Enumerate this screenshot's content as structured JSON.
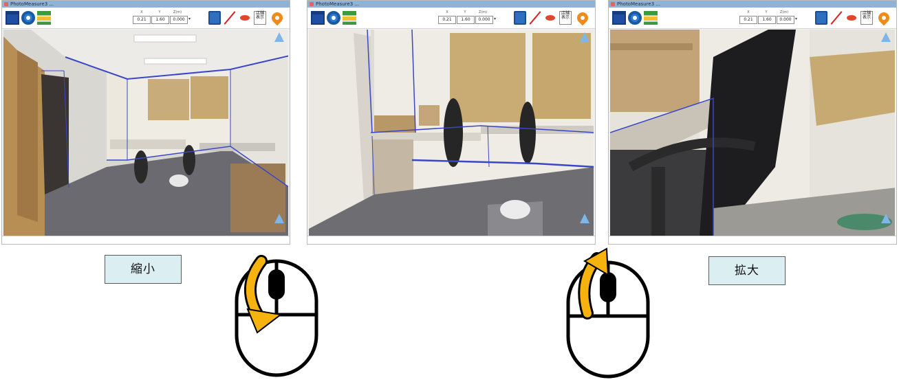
{
  "windows": [
    {
      "id": "zoomed-out",
      "title": "PhotoMeasure3 ...",
      "coords": {
        "x_label": "X",
        "y_label": "Y",
        "z_label": "Z(m)",
        "x": "0.21",
        "y": "1.60",
        "z": "0.000"
      }
    },
    {
      "id": "default",
      "title": "PhotoMeasure3 ...",
      "coords": {
        "x_label": "X",
        "y_label": "Y",
        "z_label": "Z(m)",
        "x": "0.21",
        "y": "1.60",
        "z": "0.000"
      }
    },
    {
      "id": "zoomed-in",
      "title": "PhotoMeasure3 ...",
      "coords": {
        "x_label": "X",
        "y_label": "Y",
        "z_label": "Z(m)",
        "x": "0.21",
        "y": "1.60",
        "z": "0.000"
      }
    }
  ],
  "toolbar_icons": [
    "monitor-icon",
    "gear-icon",
    "grid-icon",
    "battery-icon",
    "measure-line-icon",
    "eye-icon",
    "table-icon",
    "map-pin-icon"
  ],
  "table_icon_text": "店舗\n表示",
  "captions": {
    "zoom_out": "縮小",
    "zoom_in": "拡大"
  },
  "colors": {
    "caption_bg": "#dbeff3",
    "arrow": "#f6b20f",
    "nav_triangle": "#7fb6e6",
    "room_outline": "#3a46c8"
  }
}
